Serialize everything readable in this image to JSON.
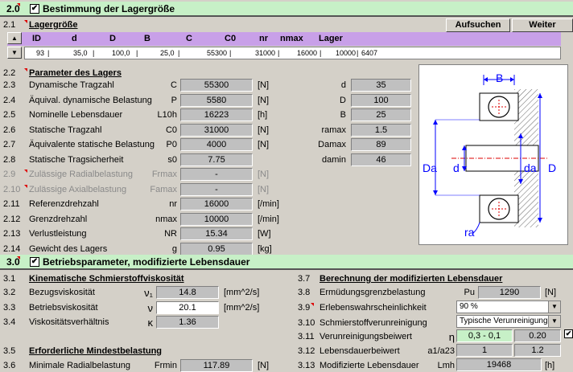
{
  "section1": {
    "num": "2.0",
    "title": "Bestimmung der Lagergröße"
  },
  "section2": {
    "num": "3.0",
    "title": "Betriebsparameter, modifizierte Lebensdauer"
  },
  "buttons": {
    "search": "Aufsuchen",
    "next": "Weiter"
  },
  "lagergroesse": {
    "num": "2.1",
    "title": "Lagergröße",
    "columns": [
      "ID",
      "d",
      "D",
      "B",
      "C",
      "C0",
      "nr",
      "nmax",
      "Lager"
    ],
    "row": [
      "93",
      "35,0",
      "100,0",
      "25,0",
      "55300",
      "31000",
      "16000",
      "10000",
      "6407"
    ]
  },
  "params": {
    "num": "2.2",
    "title": "Parameter des Lagers",
    "rows": [
      {
        "num": "2.3",
        "label": "Dynamische Tragzahl",
        "sym": "C",
        "value": "55300",
        "unit": "[N]"
      },
      {
        "num": "2.4",
        "label": "Äquival. dynamische Belastung",
        "sym": "P",
        "value": "5580",
        "unit": "[N]"
      },
      {
        "num": "2.5",
        "label": "Nominelle Lebensdauer",
        "sym": "L10h",
        "value": "16223",
        "unit": "[h]"
      },
      {
        "num": "2.6",
        "label": "Statische Tragzahl",
        "sym": "C0",
        "value": "31000",
        "unit": "[N]"
      },
      {
        "num": "2.7",
        "label": "Äquivalente statische Belastung",
        "sym": "P0",
        "value": "4000",
        "unit": "[N]"
      },
      {
        "num": "2.8",
        "label": "Statische Tragsicherheit",
        "sym": "s0",
        "value": "7.75",
        "unit": ""
      },
      {
        "num": "2.9",
        "label": "Zulässige Radialbelastung",
        "sym": "Frmax",
        "value": "-",
        "unit": "[N]"
      },
      {
        "num": "2.10",
        "label": "Zulässige Axialbelastung",
        "sym": "Famax",
        "value": "-",
        "unit": "[N]"
      },
      {
        "num": "2.11",
        "label": "Referenzdrehzahl",
        "sym": "nr",
        "value": "16000",
        "unit": "[/min]"
      },
      {
        "num": "2.12",
        "label": "Grenzdrehzahl",
        "sym": "nmax",
        "value": "10000",
        "unit": "[/min]"
      },
      {
        "num": "2.13",
        "label": "Verlustleistung",
        "sym": "NR",
        "value": "15.34",
        "unit": "[W]"
      },
      {
        "num": "2.14",
        "label": "Gewicht des Lagers",
        "sym": "g",
        "value": "0.95",
        "unit": "[kg]"
      }
    ],
    "dims": [
      {
        "sym": "d",
        "value": "35"
      },
      {
        "sym": "D",
        "value": "100"
      },
      {
        "sym": "B",
        "value": "25"
      },
      {
        "sym": "ramax",
        "value": "1.5"
      },
      {
        "sym": "Damax",
        "value": "89"
      },
      {
        "sym": "damin",
        "value": "46"
      }
    ]
  },
  "drawing": {
    "B": "B",
    "Da": "Da",
    "d": "d",
    "da": "da",
    "D": "D",
    "ra": "ra"
  },
  "kin": {
    "num": "3.1",
    "title": "Kinematische Schmierstoffviskosität",
    "rows": [
      {
        "num": "3.2",
        "label": "Bezugsviskosität",
        "sym": "ν₁",
        "value": "14.8",
        "unit": "[mm^2/s]"
      },
      {
        "num": "3.3",
        "label": "Betriebsviskosität",
        "sym": "ν",
        "value": "20.1",
        "unit": "[mm^2/s]"
      },
      {
        "num": "3.4",
        "label": "Viskositätsverhältnis",
        "sym": "κ",
        "value": "1.36",
        "unit": ""
      }
    ]
  },
  "mindest": {
    "num": "3.5",
    "title": "Erforderliche Mindestbelastung",
    "row": {
      "num": "3.6",
      "label": "Minimale Radialbelastung",
      "sym": "Frmin",
      "value": "117.89",
      "unit": "[N]"
    }
  },
  "mod": {
    "num": "3.7",
    "title": "Berechnung der modifizierten Lebensdauer",
    "r38": {
      "num": "3.8",
      "label": "Ermüdungsgrenzbelastung",
      "sym": "Pu",
      "value": "1290",
      "unit": "[N]"
    },
    "r39": {
      "num": "3.9",
      "label": "Erlebenswahrscheinlichkeit",
      "selected": "90 %"
    },
    "r310": {
      "num": "3.10",
      "label": "Schmierstoffverunreinigung",
      "selected": "Typische Verunreinigung"
    },
    "r311": {
      "num": "3.11",
      "label": "Verunreinigungsbeiwert",
      "sym": "η",
      "range": "0,3 - 0,1",
      "value": "0.20"
    },
    "r312": {
      "num": "3.12",
      "label": "Lebensdauerbeiwert",
      "sym": "a1/a23",
      "value1": "1",
      "value2": "1.2"
    },
    "r313": {
      "num": "3.13",
      "label": "Modifizierte Lebensdauer",
      "sym": "Lmh",
      "value": "19468",
      "unit": "[h]"
    }
  }
}
